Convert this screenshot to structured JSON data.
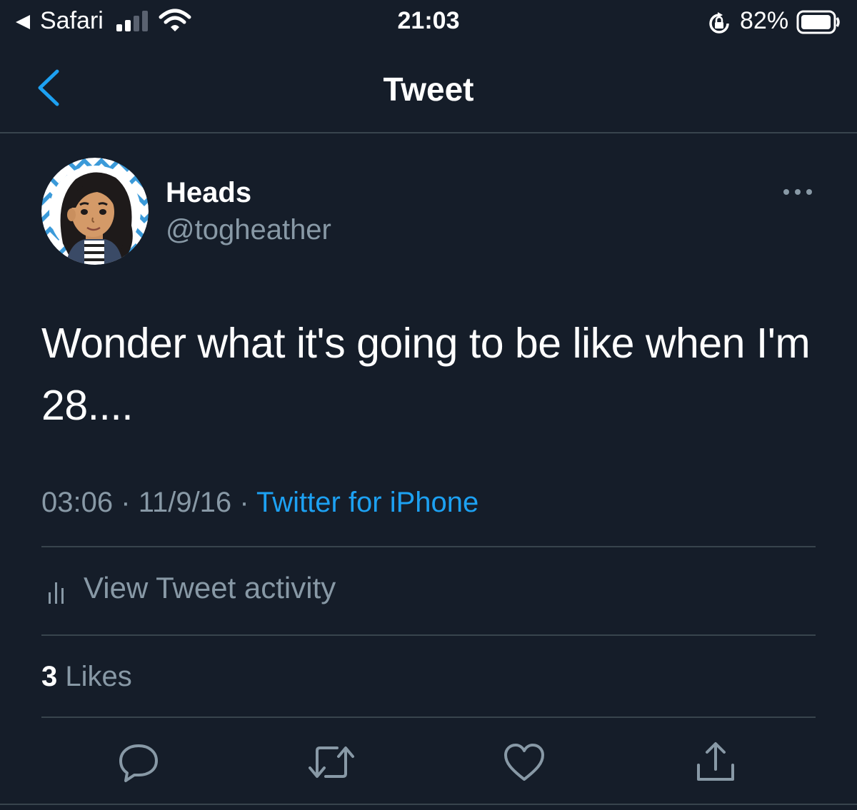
{
  "status_bar": {
    "back_app": "Safari",
    "time": "21:03",
    "battery_percent": "82%",
    "battery_level": 0.82,
    "icons": [
      "back-triangle-icon",
      "signal-icon",
      "wifi-icon",
      "rotation-lock-icon",
      "battery-icon"
    ]
  },
  "nav": {
    "title": "Tweet",
    "back_icon": "chevron-left-icon"
  },
  "tweet": {
    "display_name": "Heads",
    "handle": "@togheather",
    "text": "Wonder what it's going to be like when I'm 28....",
    "time": "03:06",
    "date": "11/9/16",
    "separator": "·",
    "source": "Twitter for iPhone",
    "likes_count": "3",
    "likes_label": "Likes"
  },
  "activity": {
    "label": "View Tweet activity",
    "icon": "bar-chart-icon"
  },
  "actions": [
    {
      "name": "reply",
      "icon": "reply-icon"
    },
    {
      "name": "retweet",
      "icon": "retweet-icon"
    },
    {
      "name": "like",
      "icon": "heart-icon"
    },
    {
      "name": "share",
      "icon": "share-icon"
    }
  ],
  "colors": {
    "background": "#151d29",
    "accent": "#1da1f2",
    "secondary_text": "#8899a6",
    "divider": "#38444d"
  }
}
